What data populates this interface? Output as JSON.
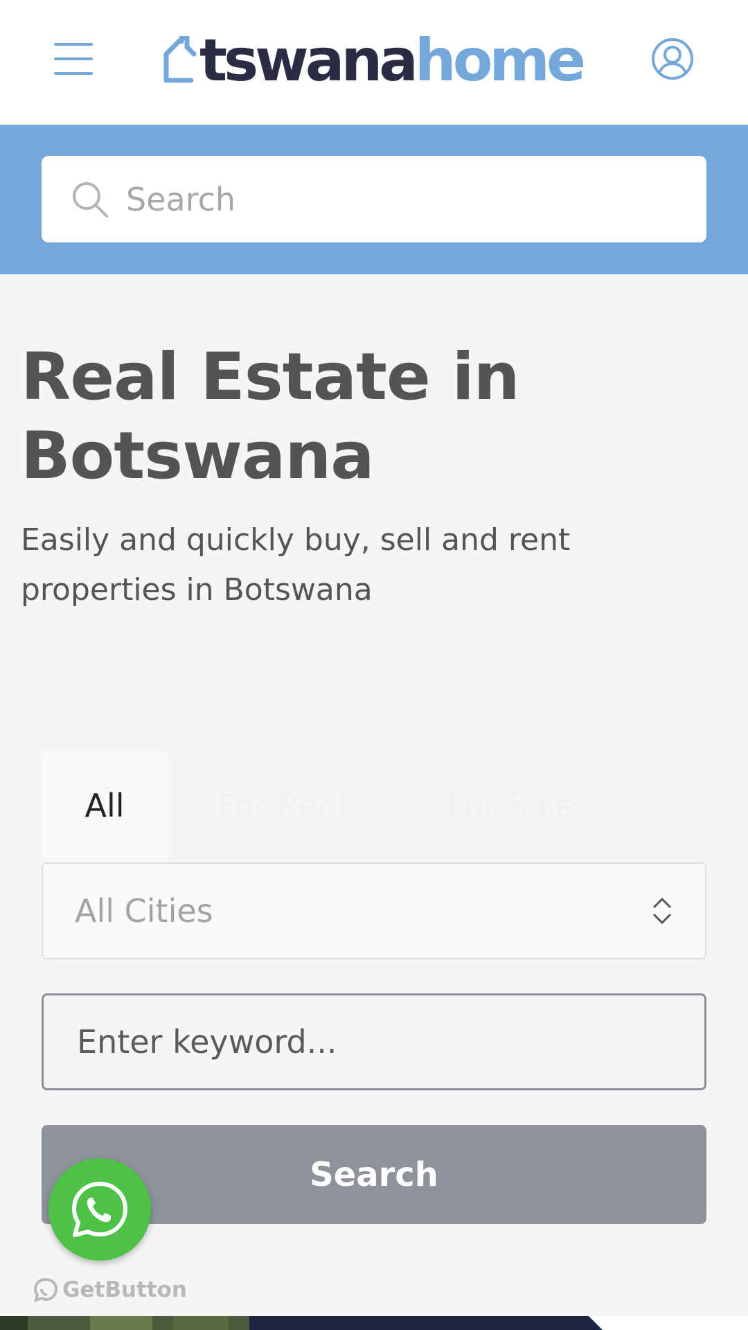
{
  "header": {
    "logo_dark": "tswana",
    "logo_light": "home",
    "menu_icon": "hamburger-icon",
    "user_icon": "user-circle-icon"
  },
  "search": {
    "placeholder": "Search",
    "icon": "search-icon"
  },
  "hero": {
    "title": "Real Estate in Botswana",
    "subtitle": "Easily and quickly buy, sell and rent properties in Botswana"
  },
  "tabs": [
    {
      "label": "All",
      "active": true
    },
    {
      "label": "For Rent",
      "active": false
    },
    {
      "label": "For Sale",
      "active": false
    }
  ],
  "form": {
    "city_value": "All Cities",
    "keyword_placeholder": "Enter keyword...",
    "search_label": "Search"
  },
  "widget": {
    "whatsapp_icon": "whatsapp-icon",
    "getbutton_label": "GetButton"
  },
  "colors": {
    "brand_blue": "#74a8db",
    "brand_dark": "#2a2c43",
    "whatsapp_green": "#4dc247",
    "button_gray": "#8e939b"
  }
}
